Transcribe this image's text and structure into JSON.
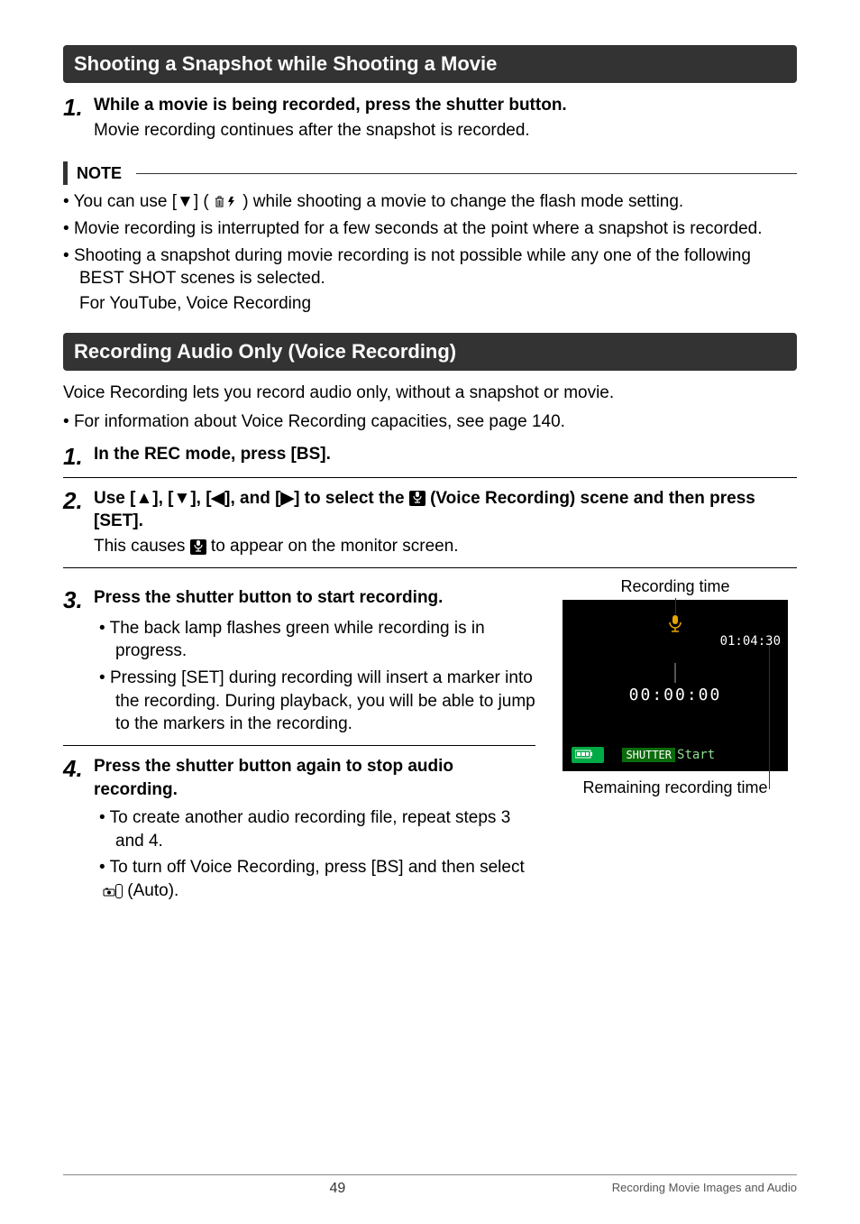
{
  "sections": {
    "snapshot": {
      "title": "Shooting a Snapshot while Shooting a Movie",
      "step1_num": "1.",
      "step1_title": "While a movie is being recorded, press the shutter button.",
      "step1_sub": "Movie recording continues after the snapshot is recorded.",
      "note_label": "NOTE",
      "note1_pre": "You can use [",
      "note1_mid": "] ( ",
      "note1_post": " ) while shooting a movie to change the flash mode setting.",
      "note2": "Movie recording is interrupted for a few seconds at the point where a snapshot is recorded.",
      "note3": "Shooting a snapshot during movie recording is not possible while any one of the following BEST SHOT scenes is selected.",
      "note3b": "For YouTube, Voice Recording"
    },
    "voice": {
      "title": "Recording Audio Only (Voice Recording)",
      "intro": "Voice Recording lets you record audio only, without a snapshot or movie.",
      "intro_bullet": "For information about Voice Recording capacities, see page 140.",
      "step1_num": "1.",
      "step1_title": "In the REC mode, press [BS].",
      "step2_num": "2.",
      "step2_title_a": "Use [",
      "step2_title_b": "], [",
      "step2_title_c": "], [",
      "step2_title_d": "], and [",
      "step2_title_e": "] to select the ",
      "step2_title_f": " (Voice Recording) scene and then press [SET].",
      "step2_sub_a": "This causes ",
      "step2_sub_b": " to appear on the monitor screen.",
      "step3_num": "3.",
      "step3_title": "Press the shutter button to start recording.",
      "step3_b1": "The back lamp flashes green while recording is in progress.",
      "step3_b2": "Pressing [SET] during recording will insert a marker into the recording. During playback, you will be able to jump to the markers in the recording.",
      "step4_num": "4.",
      "step4_title": "Press the shutter button again to stop audio recording.",
      "step4_b1": "To create another audio recording file, repeat steps 3 and 4.",
      "step4_b2_a": "To turn off Voice Recording, press [BS] and then select ",
      "step4_b2_b": " (Auto)."
    },
    "sidebar": {
      "top_label": "Recording time",
      "remaining": "01:04:30",
      "elapsed": "00:00:00",
      "shutter": "SHUTTER",
      "start": "Start",
      "bottom_label": "Remaining recording time"
    }
  },
  "footer": {
    "page": "49",
    "section": "Recording Movie Images and Audio"
  },
  "icons": {
    "down": "▼",
    "up": "▲",
    "left": "◀",
    "right": "▶",
    "trash_flash": "🗑 ⚡",
    "mic": "🎤",
    "camera": "●"
  }
}
